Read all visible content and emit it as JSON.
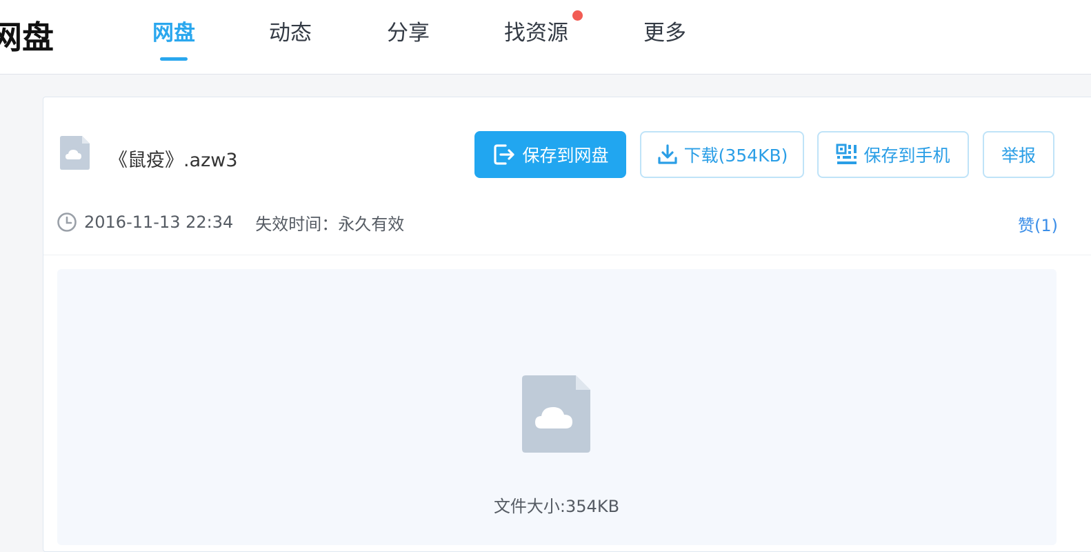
{
  "header": {
    "logo": "网盘",
    "nav": [
      {
        "label": "网盘",
        "active": true
      },
      {
        "label": "动态",
        "active": false
      },
      {
        "label": "分享",
        "active": false
      },
      {
        "label": "找资源",
        "active": false,
        "badge": "red-dot"
      },
      {
        "label": "更多",
        "active": false
      }
    ]
  },
  "file": {
    "name": "《鼠疫》.azw3",
    "date": "2016-11-13 22:34",
    "expire": "失效时间：永久有效",
    "like": "赞(1)",
    "size": "文件大小:354KB"
  },
  "actions": {
    "save": "保存到网盘",
    "download": "下载(354KB)",
    "phone": "保存到手机",
    "report": "举报"
  },
  "icons": {
    "save": "save-to-disk-icon",
    "download": "download-icon",
    "phone": "qr-code-icon",
    "clock": "clock-icon",
    "file": "cloud-file-icon"
  },
  "colors": {
    "accent": "#21a6f0",
    "like": "#3b8ee8",
    "badge": "#f25c54",
    "preview_bg": "#f5f8fd"
  }
}
